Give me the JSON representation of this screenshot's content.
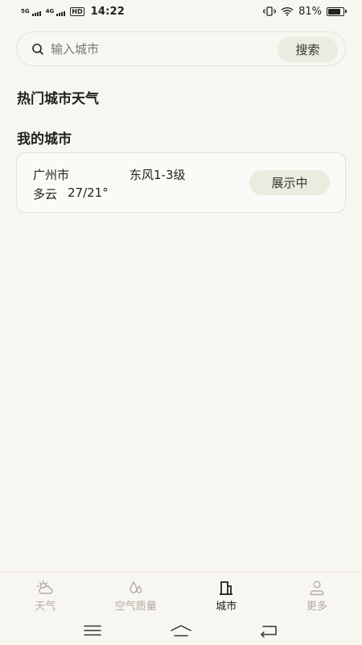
{
  "status_bar": {
    "network_1": "5G",
    "network_2": "4G",
    "hd": "HD",
    "time": "14:22",
    "battery_percent": "81%",
    "battery_level": 0.81
  },
  "search": {
    "placeholder": "输入城市",
    "button_label": "搜索"
  },
  "sections": {
    "hot_cities_title": "热门城市天气",
    "my_cities_title": "我的城市"
  },
  "my_cities": [
    {
      "name": "广州市",
      "wind": "东风1-3级",
      "condition": "多云",
      "temperature": "27/21°",
      "status_label": "展示中"
    }
  ],
  "tabs": [
    {
      "label": "天气",
      "icon": "sun-cloud-icon",
      "active": false
    },
    {
      "label": "空气质量",
      "icon": "droplets-icon",
      "active": false
    },
    {
      "label": "城市",
      "icon": "building-icon",
      "active": true
    },
    {
      "label": "更多",
      "icon": "person-icon",
      "active": false
    }
  ],
  "colors": {
    "background": "#f8f6f0",
    "pill_button": "#ecebe0",
    "tab_active": "#1f1f1f",
    "tab_inactive": "#b0aca4"
  }
}
